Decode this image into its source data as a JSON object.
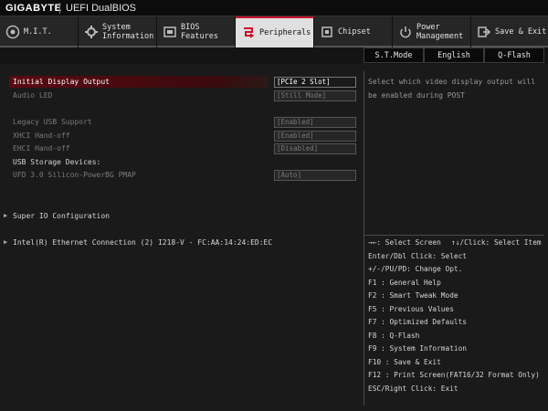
{
  "header": {
    "brand": "GIGABYTE",
    "product": "UEFI DualBIOS"
  },
  "tabs": [
    {
      "label": "M.I.T.",
      "icon": "mit-icon"
    },
    {
      "label": "System\nInformation",
      "icon": "system-info-icon"
    },
    {
      "label": "BIOS\nFeatures",
      "icon": "bios-features-icon"
    },
    {
      "label": "Peripherals",
      "icon": "peripherals-icon",
      "active": true
    },
    {
      "label": "Chipset",
      "icon": "chipset-icon"
    },
    {
      "label": "Power\nManagement",
      "icon": "power-management-icon"
    },
    {
      "label": "Save & Exit",
      "icon": "save-exit-icon"
    }
  ],
  "subbar": {
    "st_mode": "S.T.Mode",
    "language": "English",
    "qflash": "Q-Flash"
  },
  "settings": {
    "initial_display": {
      "label": "Initial Display Output",
      "value": "[PCIe 2 Slot]"
    },
    "audio_led": {
      "label": "Audio LED",
      "value": "[Still Mode]"
    },
    "legacy_usb": {
      "label": "Legacy USB Support",
      "value": "[Enabled]"
    },
    "xhci": {
      "label": "XHCI Hand-off",
      "value": "[Enabled]"
    },
    "ehci": {
      "label": "EHCI Hand-off",
      "value": "[Disabled]"
    },
    "usb_storage_header": "USB Storage Devices:",
    "ufd": {
      "label": "UFD 3.0 Silicon-PowerBG PMAP",
      "value": "[Auto]"
    },
    "super_io": "Super IO Configuration",
    "intel_eth": "Intel(R) Ethernet Connection (2) I218-V - FC:AA:14:24:ED:EC"
  },
  "help_text": "Select which video display output will be enabled during POST",
  "keys": {
    "k1a": "→←: Select Screen",
    "k1b": "↑↓/Click: Select Item",
    "k2": "Enter/Dbl Click: Select",
    "k3": "+/-/PU/PD: Change Opt.",
    "k4": "F1  : General Help",
    "k5": "F2  : Smart Tweak Mode",
    "k6": "F5  : Previous Values",
    "k7": "F7  : Optimized Defaults",
    "k8": "F8  : Q-Flash",
    "k9": "F9  : System Information",
    "k10": "F10 : Save & Exit",
    "k11": "F12 : Print Screen(FAT16/32 Format Only)",
    "k12": "ESC/Right Click: Exit"
  },
  "colors": {
    "accent": "#c8102e",
    "background": "#1a1a1a",
    "active_tab": "#e0e0e0"
  }
}
